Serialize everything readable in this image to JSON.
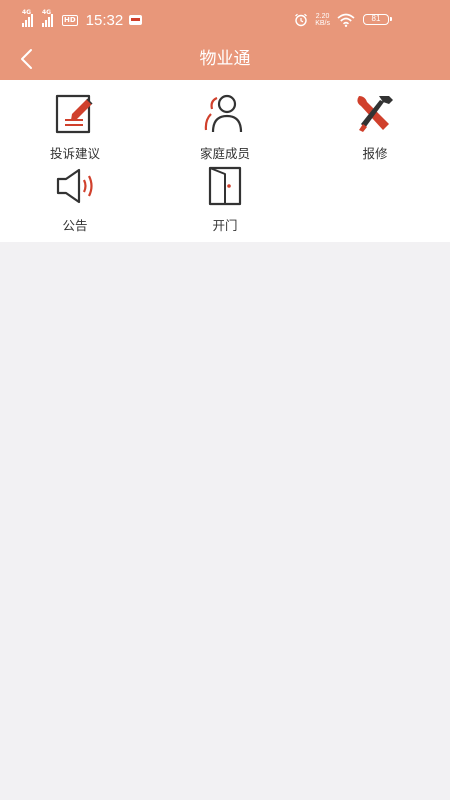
{
  "status_bar": {
    "sim1": "4G",
    "sim2": "4G",
    "hd": "HD",
    "time": "15:32",
    "speed_value": "2.20",
    "speed_unit": "KB/s",
    "battery": "81",
    "icons": [
      "signal-icon",
      "hd-icon",
      "app-notification-icon",
      "alarm-icon",
      "wifi-icon",
      "battery-icon"
    ]
  },
  "header": {
    "title": "物业通",
    "back_icon": "back-arrow-icon"
  },
  "menu": {
    "items": [
      {
        "label": "投诉建议",
        "icon": "complaint-edit-icon"
      },
      {
        "label": "家庭成员",
        "icon": "family-members-icon"
      },
      {
        "label": "报修",
        "icon": "repair-tools-icon"
      },
      {
        "label": "公告",
        "icon": "speaker-icon"
      },
      {
        "label": "开门",
        "icon": "door-icon"
      }
    ]
  },
  "colors": {
    "header_bg": "#e8977a",
    "accent_red": "#d0402c",
    "icon_dark": "#333333",
    "page_bg": "#f2f1f3"
  }
}
